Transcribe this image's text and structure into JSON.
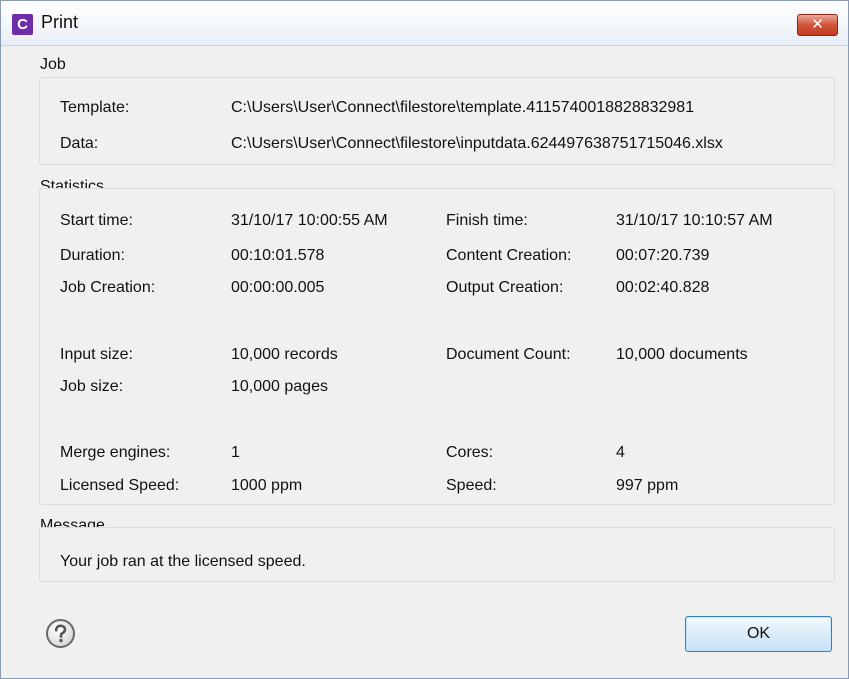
{
  "window": {
    "title": "Print",
    "app_icon_letter": "C",
    "close_symbol": "✕"
  },
  "job": {
    "legend": "Job",
    "template_label": "Template:",
    "template_value": "C:\\Users\\User\\Connect\\filestore\\template.4115740018828832981",
    "data_label": "Data:",
    "data_value": "C:\\Users\\User\\Connect\\filestore\\inputdata.624497638751715046.xlsx"
  },
  "statistics": {
    "legend": "Statistics",
    "start_time_label": "Start time:",
    "start_time_value": "31/10/17 10:00:55 AM",
    "finish_time_label": "Finish time:",
    "finish_time_value": "31/10/17 10:10:57 AM",
    "duration_label": "Duration:",
    "duration_value": "00:10:01.578",
    "content_creation_label": "Content Creation:",
    "content_creation_value": "00:07:20.739",
    "job_creation_label": "Job Creation:",
    "job_creation_value": "00:00:00.005",
    "output_creation_label": "Output Creation:",
    "output_creation_value": "00:02:40.828",
    "input_size_label": "Input size:",
    "input_size_value": "10,000 records",
    "document_count_label": "Document Count:",
    "document_count_value": "10,000 documents",
    "job_size_label": "Job size:",
    "job_size_value": "10,000 pages",
    "merge_engines_label": "Merge engines:",
    "merge_engines_value": "1",
    "cores_label": "Cores:",
    "cores_value": "4",
    "licensed_speed_label": "Licensed Speed:",
    "licensed_speed_value": "1000 ppm",
    "speed_label": "Speed:",
    "speed_value": "997 ppm"
  },
  "message": {
    "legend": "Message",
    "text": "Your job ran at the licensed speed."
  },
  "footer": {
    "help_icon": "question-mark-circle",
    "ok_label": "OK"
  },
  "colors": {
    "app_icon": "#6f2da8",
    "close_button": "#c23a20",
    "ok_border": "#3c7fb1"
  }
}
